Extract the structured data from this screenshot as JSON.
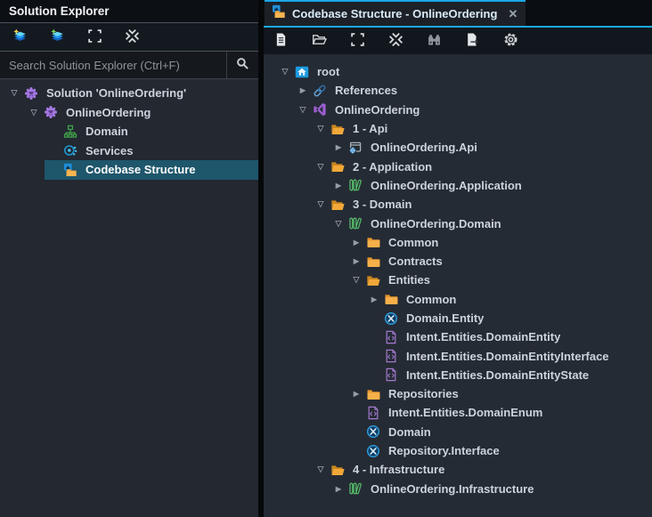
{
  "left_panel": {
    "title": "Solution Explorer",
    "toolbar": [
      {
        "name": "new-view-layers-button",
        "icon": "layers-star-yellow"
      },
      {
        "name": "add-view-layers-button",
        "icon": "layers-star-green"
      },
      {
        "name": "expand-all-button",
        "icon": "expand-all"
      },
      {
        "name": "collapse-all-button",
        "icon": "collapse-all"
      }
    ],
    "search": {
      "placeholder": "Search Solution Explorer (Ctrl+F)",
      "icon": "search"
    },
    "tree": [
      {
        "label": "Solution 'OnlineOrdering'",
        "level": 0,
        "arrow": "open",
        "icon": "solution-gear",
        "selected": false
      },
      {
        "label": "OnlineOrdering",
        "level": 1,
        "arrow": "open",
        "icon": "solution-gear",
        "selected": false
      },
      {
        "label": "Domain",
        "level": 2,
        "arrow": "none",
        "icon": "org-chart",
        "selected": false
      },
      {
        "label": "Services",
        "level": 2,
        "arrow": "none",
        "icon": "services",
        "selected": false
      },
      {
        "label": "Codebase Structure",
        "level": 2,
        "arrow": "none",
        "icon": "codebase-folder",
        "selected": true
      }
    ]
  },
  "right_panel": {
    "tab": {
      "title": "Codebase Structure - OnlineOrdering",
      "icon": "codebase-folder",
      "close_glyph": "✕"
    },
    "toolbar": [
      {
        "name": "new-file-button",
        "icon": "doc"
      },
      {
        "name": "open-folder-button",
        "icon": "open-folder-outline"
      },
      {
        "name": "expand-all-button",
        "icon": "expand-all"
      },
      {
        "name": "collapse-all-button",
        "icon": "collapse-all"
      },
      {
        "name": "find-button",
        "icon": "binoculars"
      },
      {
        "name": "export-button",
        "icon": "export"
      },
      {
        "name": "settings-button",
        "icon": "gear"
      }
    ],
    "tree": [
      {
        "label": "root",
        "level": 0,
        "arrow": "open",
        "icon": "home"
      },
      {
        "label": "References",
        "level": 1,
        "arrow": "collapsed",
        "icon": "link"
      },
      {
        "label": "OnlineOrdering",
        "level": 1,
        "arrow": "open",
        "icon": "vs-logo"
      },
      {
        "label": "1 - Api",
        "level": 2,
        "arrow": "open",
        "icon": "folder-open"
      },
      {
        "label": "OnlineOrdering.Api",
        "level": 3,
        "arrow": "collapsed",
        "icon": "webapp"
      },
      {
        "label": "2 - Application",
        "level": 2,
        "arrow": "open",
        "icon": "folder-open"
      },
      {
        "label": "OnlineOrdering.Application",
        "level": 3,
        "arrow": "collapsed",
        "icon": "library"
      },
      {
        "label": "3 - Domain",
        "level": 2,
        "arrow": "open",
        "icon": "folder-open"
      },
      {
        "label": "OnlineOrdering.Domain",
        "level": 3,
        "arrow": "open",
        "icon": "library"
      },
      {
        "label": "Common",
        "level": 4,
        "arrow": "collapsed",
        "icon": "folder-closed"
      },
      {
        "label": "Contracts",
        "level": 4,
        "arrow": "collapsed",
        "icon": "folder-closed"
      },
      {
        "label": "Entities",
        "level": 4,
        "arrow": "open",
        "icon": "folder-open"
      },
      {
        "label": "Common",
        "level": 5,
        "arrow": "collapsed",
        "icon": "folder-closed"
      },
      {
        "label": "Domain.Entity",
        "level": 5,
        "arrow": "none",
        "icon": "template"
      },
      {
        "label": "Intent.Entities.DomainEntity",
        "level": 5,
        "arrow": "none",
        "icon": "code-file"
      },
      {
        "label": "Intent.Entities.DomainEntityInterface",
        "level": 5,
        "arrow": "none",
        "icon": "code-file"
      },
      {
        "label": "Intent.Entities.DomainEntityState",
        "level": 5,
        "arrow": "none",
        "icon": "code-file"
      },
      {
        "label": "Repositories",
        "level": 4,
        "arrow": "collapsed",
        "icon": "folder-closed"
      },
      {
        "label": "Intent.Entities.DomainEnum",
        "level": 4,
        "arrow": "none",
        "icon": "code-file"
      },
      {
        "label": "Domain",
        "level": 4,
        "arrow": "none",
        "icon": "template"
      },
      {
        "label": "Repository.Interface",
        "level": 4,
        "arrow": "none",
        "icon": "template"
      },
      {
        "label": "4 - Infrastructure",
        "level": 2,
        "arrow": "open",
        "icon": "folder-open"
      },
      {
        "label": "OnlineOrdering.Infrastructure",
        "level": 3,
        "arrow": "collapsed",
        "icon": "library"
      }
    ]
  },
  "colors": {
    "accent_cyan": "#1ba7e8",
    "selection_teal": "#1e566b",
    "folder_orange": "#f0a53d",
    "library_green": "#55b96a",
    "file_purple": "#a379cf",
    "template_blue": "#2e9fe0",
    "solution_purple": "#a678e2"
  }
}
